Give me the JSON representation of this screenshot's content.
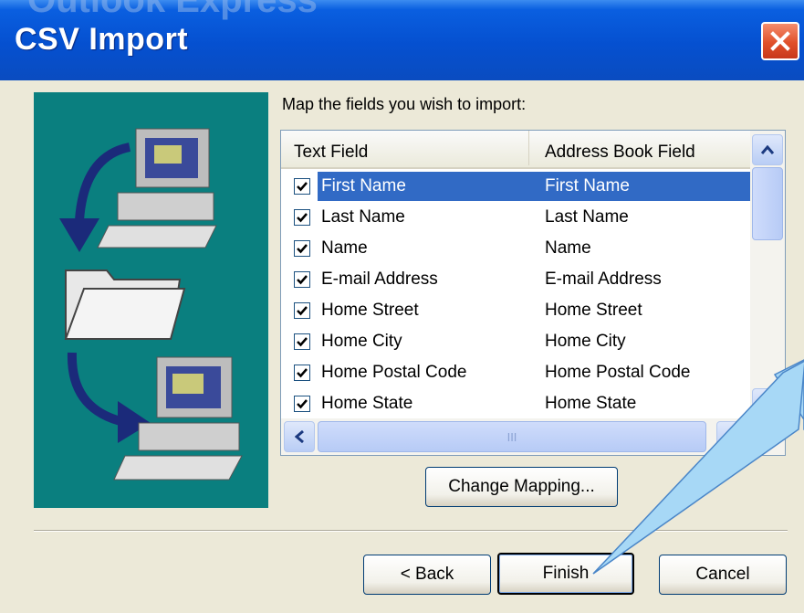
{
  "window": {
    "title": "CSV Import",
    "behind_title": "Outlook Express",
    "close_icon": "close-x-icon"
  },
  "colors": {
    "titlebar": "#0a5fe0",
    "illustration_bg": "#0a7f7f",
    "selection": "#316ac5",
    "dialog_bg": "#ece9d8",
    "callout_fill": "#a7d8f6"
  },
  "illustration": {
    "icons": [
      "computer-icon",
      "arrow-curve-down-icon",
      "folder-icon",
      "arrow-curve-right-icon",
      "computer-icon"
    ]
  },
  "mapping": {
    "prompt": "Map the fields you wish to import:",
    "columns": [
      "Text Field",
      "Address Book Field"
    ],
    "rows": [
      {
        "checked": true,
        "text_field": "First Name",
        "address_field": "First Name",
        "selected": true
      },
      {
        "checked": true,
        "text_field": "Last Name",
        "address_field": "Last Name",
        "selected": false
      },
      {
        "checked": true,
        "text_field": "Name",
        "address_field": "Name",
        "selected": false
      },
      {
        "checked": true,
        "text_field": "E-mail Address",
        "address_field": "E-mail Address",
        "selected": false
      },
      {
        "checked": true,
        "text_field": "Home Street",
        "address_field": "Home Street",
        "selected": false
      },
      {
        "checked": true,
        "text_field": "Home City",
        "address_field": "Home City",
        "selected": false
      },
      {
        "checked": true,
        "text_field": "Home Postal Code",
        "address_field": "Home Postal Code",
        "selected": false
      },
      {
        "checked": true,
        "text_field": "Home State",
        "address_field": "Home State",
        "selected": false
      }
    ],
    "hscroll_grip": "III"
  },
  "buttons": {
    "change_mapping": "Change Mapping...",
    "back": "< Back",
    "finish": "Finish",
    "cancel": "Cancel"
  }
}
